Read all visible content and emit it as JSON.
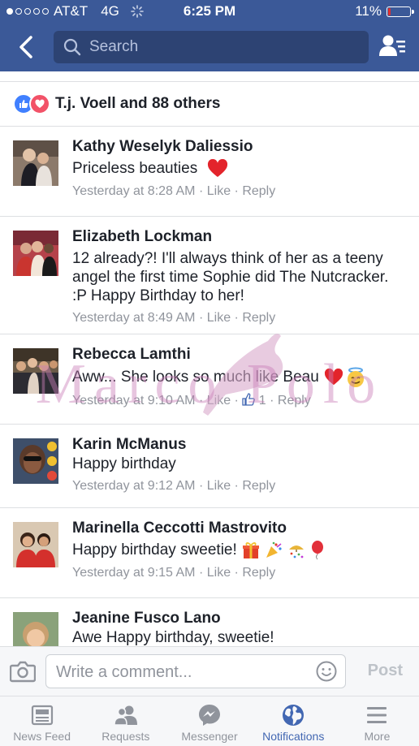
{
  "status_bar": {
    "carrier": "AT&T",
    "network": "4G",
    "time": "6:25 PM",
    "battery": "11%",
    "battery_level": 0.11,
    "signal_bars_filled": 1,
    "signal_bars_total": 5
  },
  "nav": {
    "search_placeholder": "Search"
  },
  "reactions": {
    "summary": "T.j. Voell and 88 others"
  },
  "comments": [
    {
      "name": "Kathy Weselyk Daliessio",
      "text": "Priceless beauties",
      "time": "Yesterday at 8:28 AM",
      "like": "Like",
      "reply": "Reply"
    },
    {
      "name": "Elizabeth Lockman",
      "text": "12 already?! I'll always think of her as a teeny angel the first time Sophie did The Nutcracker. :P Happy Birthday to her!",
      "time": "Yesterday at 8:49 AM",
      "like": "Like",
      "reply": "Reply"
    },
    {
      "name": "Rebecca Lamthi",
      "text": "Aww... She looks so much like Beau",
      "time": "Yesterday at 9:10 AM",
      "like": "Like",
      "like_count": "1",
      "reply": "Reply"
    },
    {
      "name": "Karin McManus",
      "text": "Happy birthday",
      "time": "Yesterday at 9:12 AM",
      "like": "Like",
      "reply": "Reply"
    },
    {
      "name": "Marinella Ceccotti Mastrovito",
      "text": "Happy birthday sweetie!",
      "time": "Yesterday at 9:15 AM",
      "like": "Like",
      "reply": "Reply"
    },
    {
      "name": "Jeanine Fusco Lano",
      "text": "Awe Happy birthday, sweetie!"
    }
  ],
  "watermark": "Marco Polo",
  "composer": {
    "placeholder": "Write a comment...",
    "post_label": "Post"
  },
  "tabs": [
    {
      "label": "News Feed",
      "icon": "news-feed-icon"
    },
    {
      "label": "Requests",
      "icon": "friends-icon"
    },
    {
      "label": "Messenger",
      "icon": "messenger-icon"
    },
    {
      "label": "Notifications",
      "icon": "globe-icon",
      "active": true
    },
    {
      "label": "More",
      "icon": "menu-icon"
    }
  ],
  "colors": {
    "brand": "#3b5998",
    "active_tab": "#4267b2",
    "meta_text": "#90949c"
  }
}
